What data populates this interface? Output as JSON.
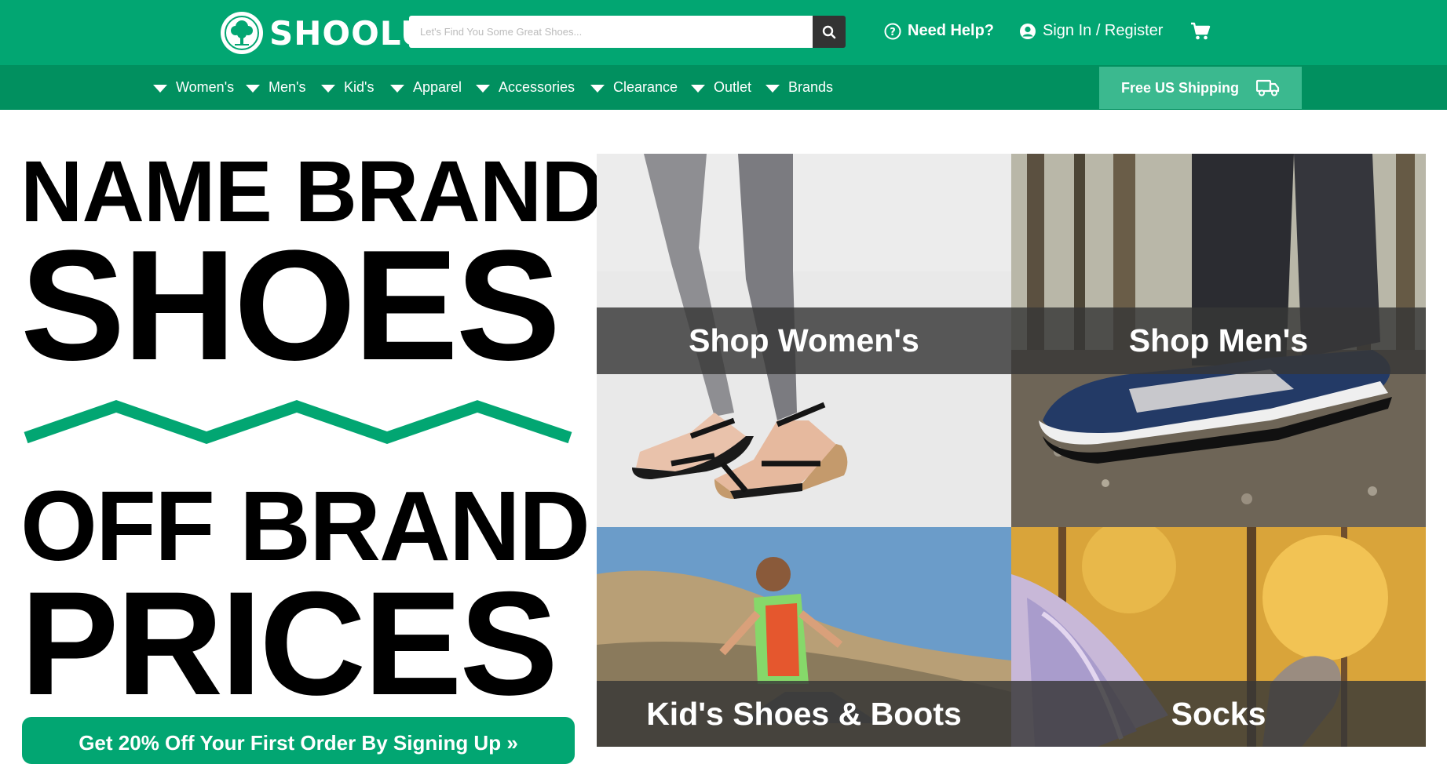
{
  "header": {
    "brand": "SHOOLU",
    "search_placeholder": "Let's Find You Some Great Shoes...",
    "help": "Need Help?",
    "signin": "Sign In / Register"
  },
  "nav": {
    "items": [
      "Women's",
      "Men's",
      "Kid's",
      "Apparel",
      "Accessories",
      "Clearance",
      "Outlet",
      "Brands"
    ],
    "shipping": "Free US Shipping"
  },
  "hero": {
    "line1": "NAME BRAND",
    "line2": "SHOES",
    "line3": "OFF BRAND",
    "line4": "PRICES",
    "cta": "Get 20% Off Your First Order By Signing Up »"
  },
  "tiles": {
    "womens": "Shop Women's",
    "mens": "Shop Men's",
    "kids": "Kid's Shoes & Boots",
    "socks": "Socks"
  },
  "colors": {
    "brand_green": "#02a672",
    "nav_green": "#01905f"
  }
}
